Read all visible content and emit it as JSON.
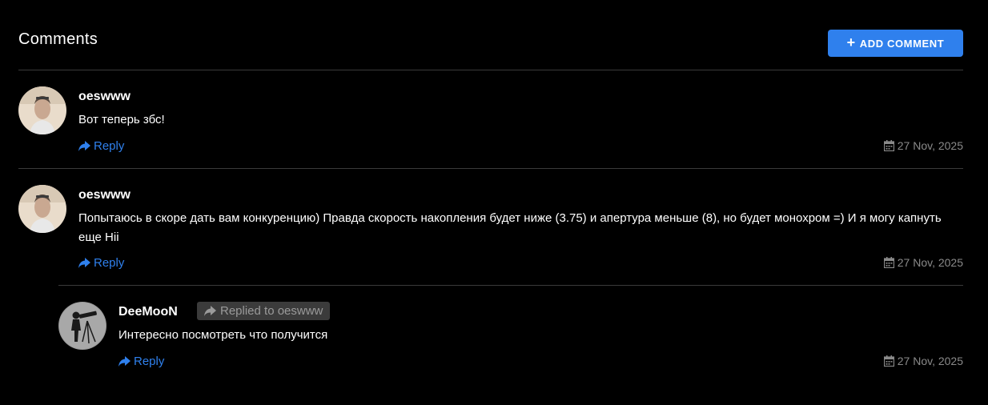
{
  "section": {
    "title": "Comments",
    "add_button_label": "ADD COMMENT"
  },
  "comments": [
    {
      "author": "oeswww",
      "text": "Вот теперь збс!",
      "reply_label": "Reply",
      "date": "27 Nov, 2025"
    },
    {
      "author": "oeswww",
      "text": "Попытаюсь в скоре дать вам конкуренцию) Правда скорость накопления будет ниже (3.75) и апертура меньше (8), но будет монохром =) И я могу капнуть еще Hii",
      "reply_label": "Reply",
      "date": "27 Nov, 2025"
    },
    {
      "author": "DeeMooN",
      "replied_to": "Replied to oeswww",
      "text": "Интересно посмотреть что получится",
      "reply_label": "Reply",
      "date": "27 Nov, 2025"
    }
  ],
  "colors": {
    "accent": "#2f80ed",
    "background": "#000000",
    "divider": "#3a3a3a",
    "muted": "#8a8a8a"
  },
  "icons": [
    "plus-icon",
    "reply-arrow-icon",
    "calendar-icon"
  ]
}
